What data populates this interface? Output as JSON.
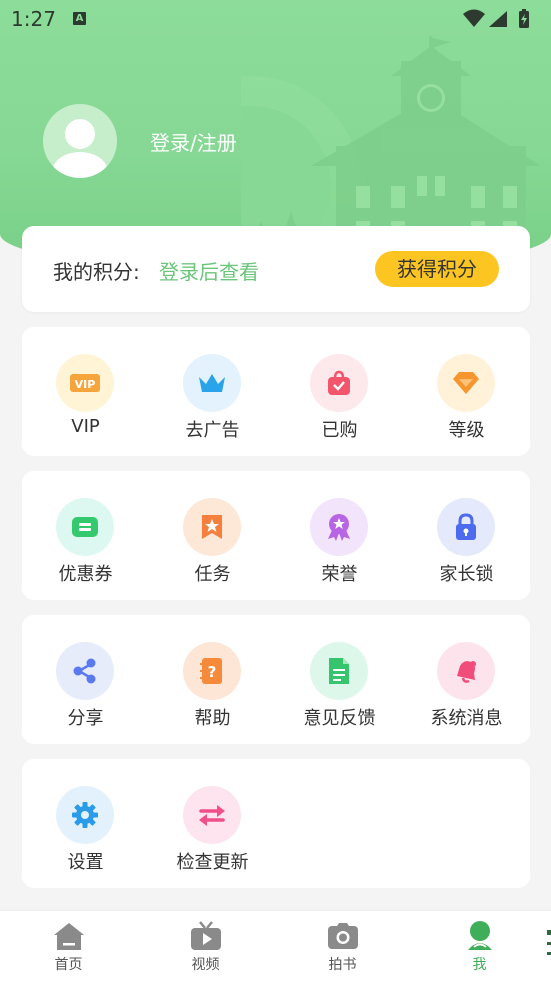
{
  "status": {
    "time": "1:27",
    "a_icon": "A"
  },
  "profile": {
    "login_label": "登录/注册"
  },
  "points": {
    "label": "我的积分:",
    "value": "登录后查看",
    "button": "获得积分"
  },
  "grids": [
    {
      "items": [
        {
          "label": "VIP",
          "icon": "vip-icon"
        },
        {
          "label": "去广告",
          "icon": "crown-icon"
        },
        {
          "label": "已购",
          "icon": "bag-icon"
        },
        {
          "label": "等级",
          "icon": "diamond-icon"
        }
      ]
    },
    {
      "items": [
        {
          "label": "优惠券",
          "icon": "coupon-icon"
        },
        {
          "label": "任务",
          "icon": "bookmark-star-icon"
        },
        {
          "label": "荣誉",
          "icon": "medal-icon"
        },
        {
          "label": "家长锁",
          "icon": "lock-icon"
        }
      ]
    },
    {
      "items": [
        {
          "label": "分享",
          "icon": "share-icon"
        },
        {
          "label": "帮助",
          "icon": "help-book-icon"
        },
        {
          "label": "意见反馈",
          "icon": "feedback-doc-icon"
        },
        {
          "label": "系统消息",
          "icon": "message-bell-icon"
        }
      ]
    },
    {
      "items": [
        {
          "label": "设置",
          "icon": "gear-icon"
        },
        {
          "label": "检查更新",
          "icon": "refresh-icon"
        }
      ]
    }
  ],
  "nav": [
    {
      "label": "首页",
      "icon": "home-icon"
    },
    {
      "label": "视频",
      "icon": "tv-icon"
    },
    {
      "label": "拍书",
      "icon": "camera-icon"
    },
    {
      "label": "我",
      "icon": "profile-icon",
      "active": true
    }
  ],
  "colors": {
    "accent": "#3fae58",
    "header": "#8ddc9a",
    "button": "#fdc521"
  }
}
